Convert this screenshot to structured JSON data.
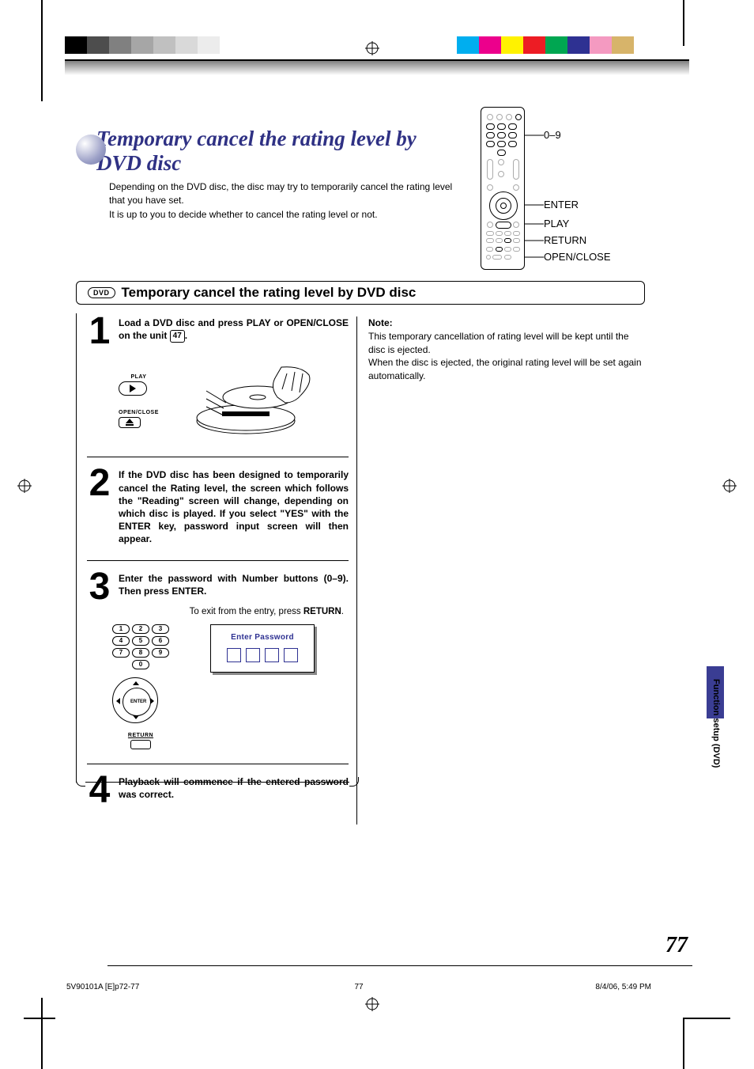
{
  "header": {
    "title": "Temporary cancel the rating level by DVD disc",
    "subtext1": "Depending on the DVD disc, the disc may try to temporarily cancel the rating level that you have set.",
    "subtext2": "It is up to you to decide whether to cancel the rating level or not."
  },
  "remote_labels": {
    "numbers": "0–9",
    "enter": "ENTER",
    "play": "PLAY",
    "return": "RETURN",
    "open_close": "OPEN/CLOSE"
  },
  "section": {
    "badge": "DVD",
    "heading": "Temporary cancel the rating level by DVD disc"
  },
  "steps": [
    {
      "n": "1",
      "text_a": "Load a DVD disc and press PLAY or OPEN/CLOSE on the unit ",
      "page_ref": "47",
      "text_b": ".",
      "play_label": "PLAY",
      "oc_label": "OPEN/CLOSE"
    },
    {
      "n": "2",
      "text": "If the DVD disc has been designed to temporarily cancel the Rating level, the screen which follows the \"Reading\" screen will change, depending on which disc is played. If you select \"YES\" with the ENTER key,  password input screen will then appear."
    },
    {
      "n": "3",
      "text": "Enter the password with Number buttons (0–9). Then press ENTER.",
      "exit_a": "To exit from the entry, press ",
      "exit_b": "RETURN",
      "exit_c": ".",
      "panel_title": "Enter Password",
      "numpad": [
        "1",
        "2",
        "3",
        "4",
        "5",
        "6",
        "7",
        "8",
        "9",
        "0"
      ],
      "dpad_center": "ENTER",
      "return_label": "RETURN"
    },
    {
      "n": "4",
      "text": "Playback will commence if the entered password was correct."
    }
  ],
  "note": {
    "heading": "Note:",
    "line1": "This temporary cancellation of rating level will be kept until the disc is ejected.",
    "line2": "When the disc is ejected, the original rating level will be set again automatically."
  },
  "side_tab": "Function setup (DVD)",
  "page_number": "77",
  "footer": {
    "left": "5V90101A [E]p72-77",
    "center": "77",
    "right": "8/4/06, 5:49 PM"
  }
}
